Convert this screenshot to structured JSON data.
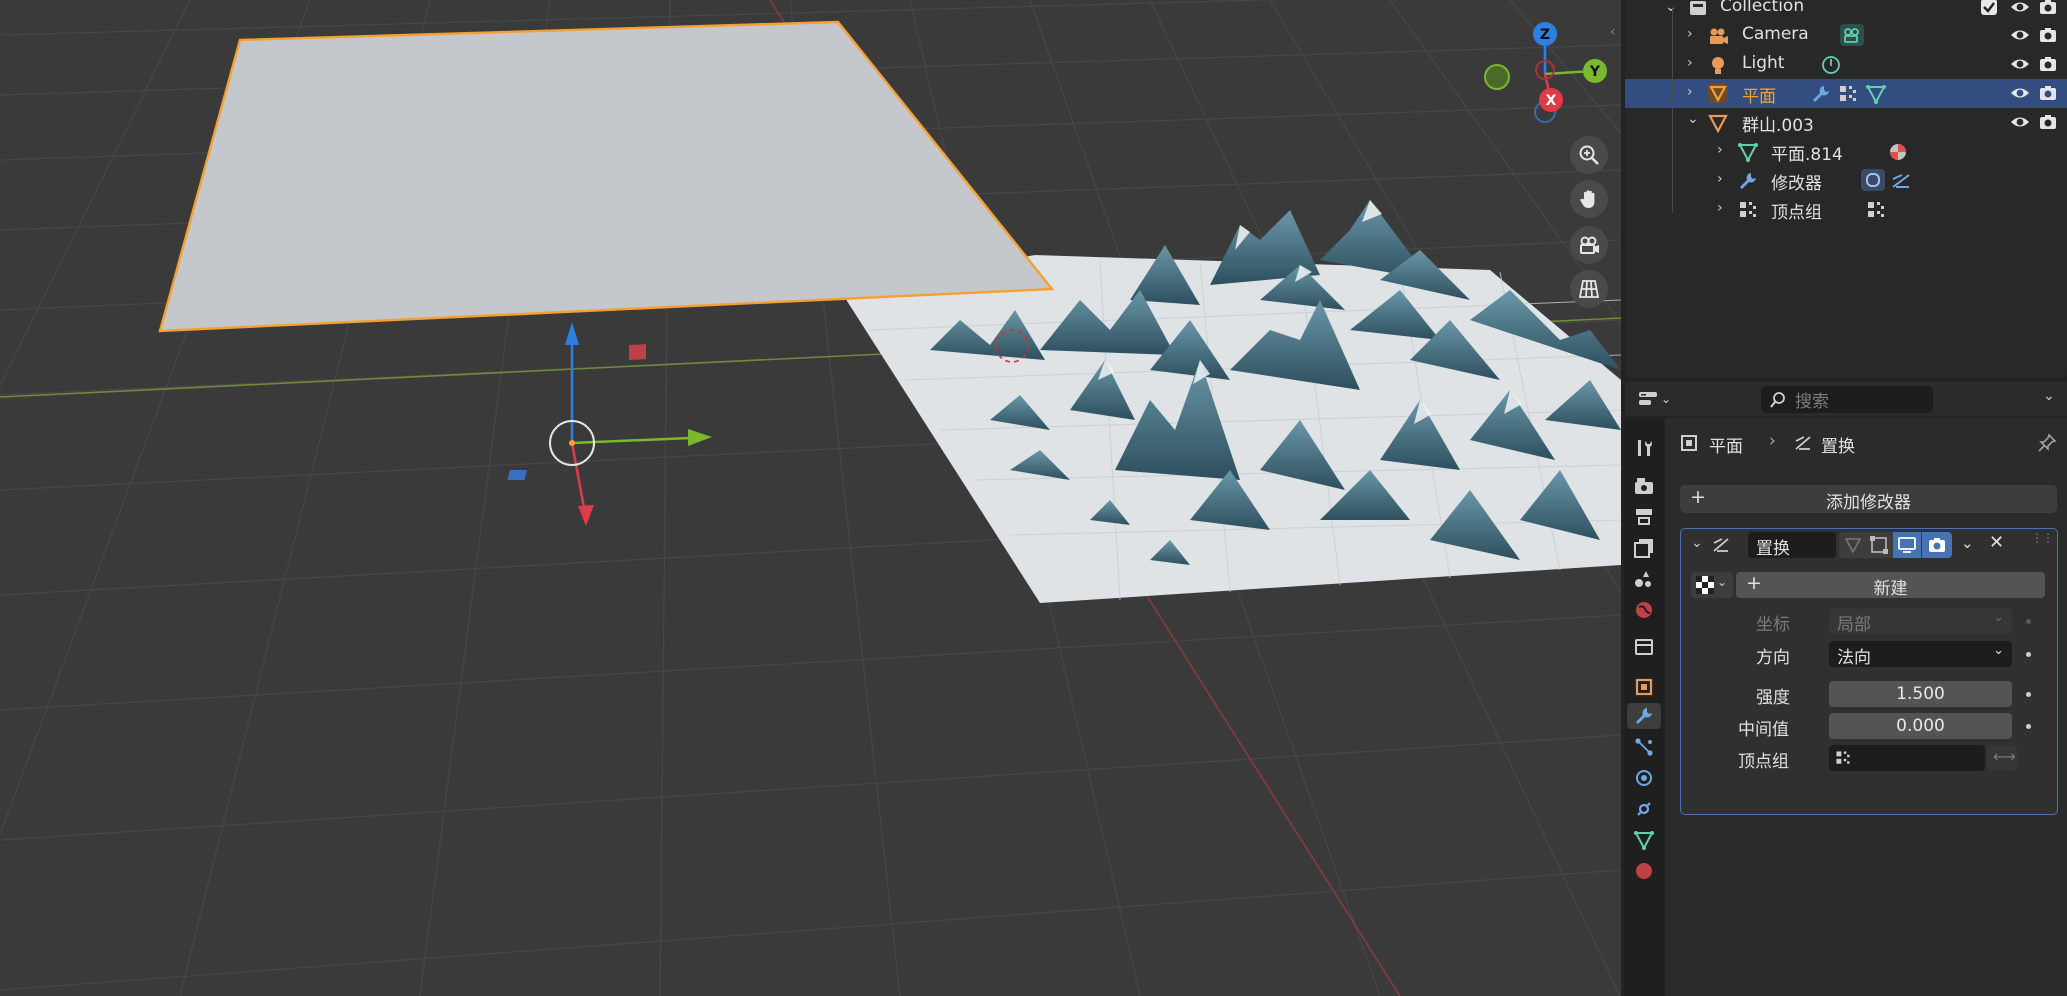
{
  "outliner": {
    "rows": [
      {
        "label": "Collection"
      },
      {
        "label": "Camera"
      },
      {
        "label": "Light"
      },
      {
        "label": "平面"
      },
      {
        "label": "群山.003"
      },
      {
        "label": "平面.814"
      },
      {
        "label": "修改器"
      },
      {
        "label": "顶点组"
      }
    ]
  },
  "props_header": {
    "search_placeholder": "搜索"
  },
  "properties": {
    "breadcrumb": {
      "object": "平面",
      "modifier": "置换"
    },
    "add_modifier_label": "添加修改器",
    "modifier": {
      "name": "置换",
      "new_texture_label": "新建",
      "coords_label": "坐标",
      "coords_value": "局部",
      "direction_label": "方向",
      "direction_value": "法向",
      "strength_label": "强度",
      "strength_value": "1.500",
      "midlevel_label": "中间值",
      "midlevel_value": "0.000",
      "vgroup_label": "顶点组",
      "vgroup_value": ""
    }
  },
  "gizmo": {
    "z": "Z",
    "y": "Y",
    "x": "X"
  },
  "colors": {
    "selection": "#334d80",
    "accent_orange": "#f5a030",
    "axis_x": "#e23a48",
    "axis_y": "#79b82f",
    "axis_z": "#2d7fe2"
  }
}
